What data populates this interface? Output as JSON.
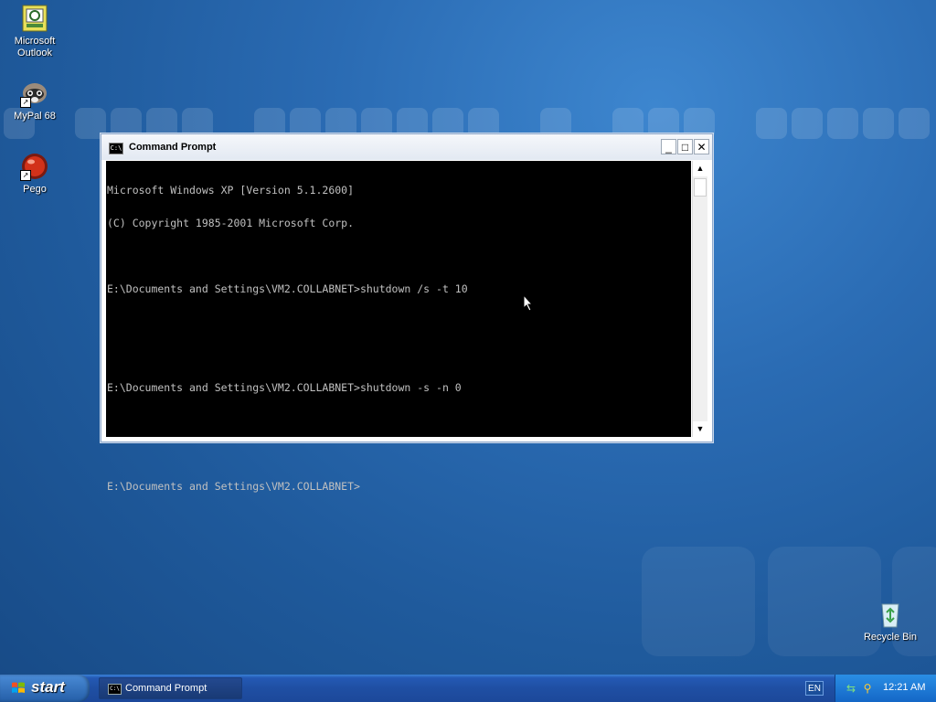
{
  "desktop": {
    "icons": [
      {
        "label": "Microsoft Outlook",
        "icon": "outlook-icon"
      },
      {
        "label": "MyPal 68",
        "icon": "mypal-icon"
      },
      {
        "label": "Pego",
        "icon": "pego-icon"
      },
      {
        "label": "Recycle Bin",
        "icon": "recycle-bin-icon"
      }
    ]
  },
  "window": {
    "title": "Command Prompt",
    "buttons": {
      "minimize": "_",
      "maximize": "□",
      "close": "✕"
    },
    "console_lines": [
      "Microsoft Windows XP [Version 5.1.2600]",
      "(C) Copyright 1985-2001 Microsoft Corp.",
      "",
      "E:\\Documents and Settings\\VM2.COLLABNET>shutdown /s -t 10",
      "",
      "",
      "E:\\Documents and Settings\\VM2.COLLABNET>shutdown -s -n 0",
      "",
      "",
      "E:\\Documents and Settings\\VM2.COLLABNET>"
    ],
    "scroll_up": "▲",
    "scroll_down": "▼"
  },
  "taskbar": {
    "start_label": "start",
    "task_button_label": "Command Prompt",
    "language": "EN",
    "clock": "12:21 AM"
  }
}
